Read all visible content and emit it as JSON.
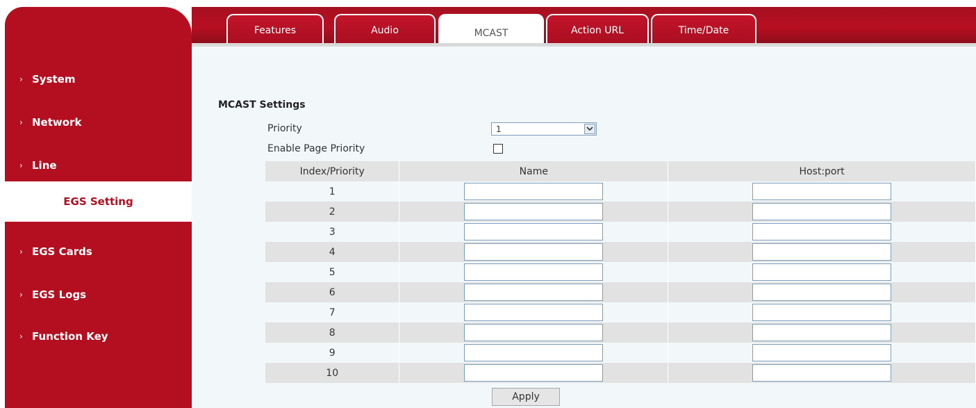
{
  "sidebar": {
    "items": [
      {
        "label": "System",
        "active": false
      },
      {
        "label": "Network",
        "active": false
      },
      {
        "label": "Line",
        "active": false
      },
      {
        "label": "EGS Setting",
        "active": true
      },
      {
        "label": "EGS Cards",
        "active": false
      },
      {
        "label": "EGS Logs",
        "active": false
      },
      {
        "label": "Function Key",
        "active": false
      }
    ]
  },
  "tabs": [
    {
      "label": "Features",
      "active": false
    },
    {
      "label": "Audio",
      "active": false
    },
    {
      "label": "MCAST",
      "active": true
    },
    {
      "label": "Action URL",
      "active": false
    },
    {
      "label": "Time/Date",
      "active": false
    }
  ],
  "colors": {
    "brand_red": "#b30f21",
    "panel_bg": "#f2f8fa",
    "row_alt": "#e2e2e2"
  },
  "mcast": {
    "section_title": "MCAST Settings",
    "priority_label": "Priority",
    "priority_value": "1",
    "enable_page_priority_label": "Enable Page Priority",
    "enable_page_priority_checked": false,
    "table": {
      "headers": [
        "Index/Priority",
        "Name",
        "Host:port"
      ],
      "rows": [
        {
          "index": "1",
          "name": "",
          "host": ""
        },
        {
          "index": "2",
          "name": "",
          "host": ""
        },
        {
          "index": "3",
          "name": "",
          "host": ""
        },
        {
          "index": "4",
          "name": "",
          "host": ""
        },
        {
          "index": "5",
          "name": "",
          "host": ""
        },
        {
          "index": "6",
          "name": "",
          "host": ""
        },
        {
          "index": "7",
          "name": "",
          "host": ""
        },
        {
          "index": "8",
          "name": "",
          "host": ""
        },
        {
          "index": "9",
          "name": "",
          "host": ""
        },
        {
          "index": "10",
          "name": "",
          "host": ""
        }
      ]
    },
    "apply_label": "Apply"
  }
}
